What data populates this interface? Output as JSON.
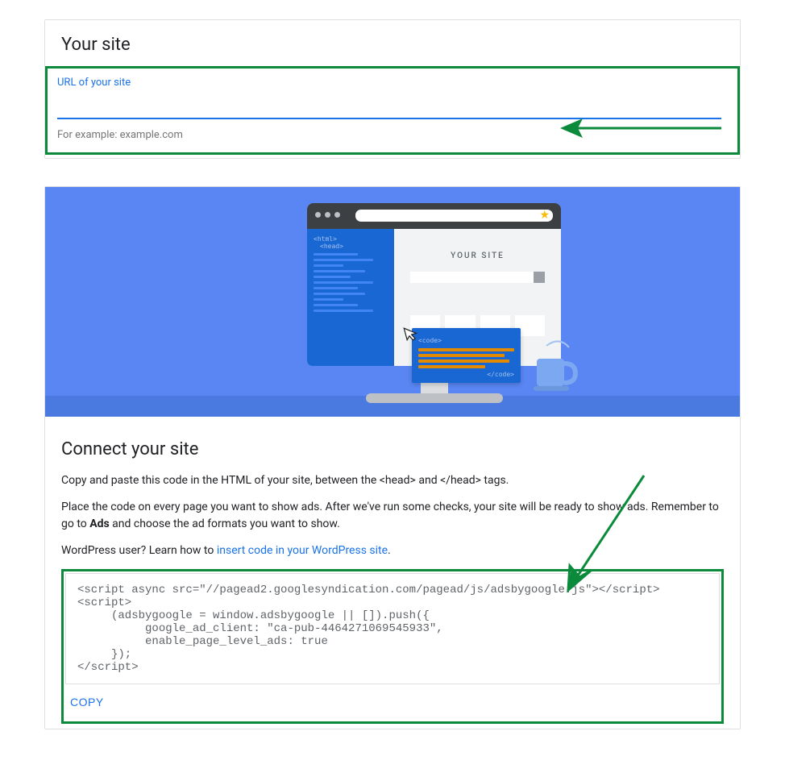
{
  "site_card": {
    "title": "Your site",
    "url_label": "URL of your site",
    "url_value": "",
    "helper": "For example: example.com"
  },
  "illustration": {
    "page_label": "YOUR SITE",
    "code_open": "<html>",
    "head_open": "<head>",
    "popup_open": "<code>",
    "popup_close": "</code>"
  },
  "connect": {
    "title": "Connect your site",
    "intro": "Copy and paste this code in the HTML of your site, between the <head> and </head> tags.",
    "para2_a": "Place the code on every page you want to show ads. After we've run some checks, your site will be ready to show ads. Remember to go to ",
    "para2_b": "Ads",
    "para2_c": " and choose the ad formats you want to show.",
    "wp_pre": "WordPress user? Learn how to ",
    "wp_link": "insert code in your WordPress site",
    "wp_post": ".",
    "code": "<script async src=\"//pagead2.googlesyndication.com/pagead/js/adsbygoogle.js\"></script>\n<script>\n     (adsbygoogle = window.adsbygoogle || []).push({\n          google_ad_client: \"ca-pub-4464271069545933\",\n          enable_page_level_ads: true\n     });\n</script>",
    "copy_label": "COPY"
  }
}
